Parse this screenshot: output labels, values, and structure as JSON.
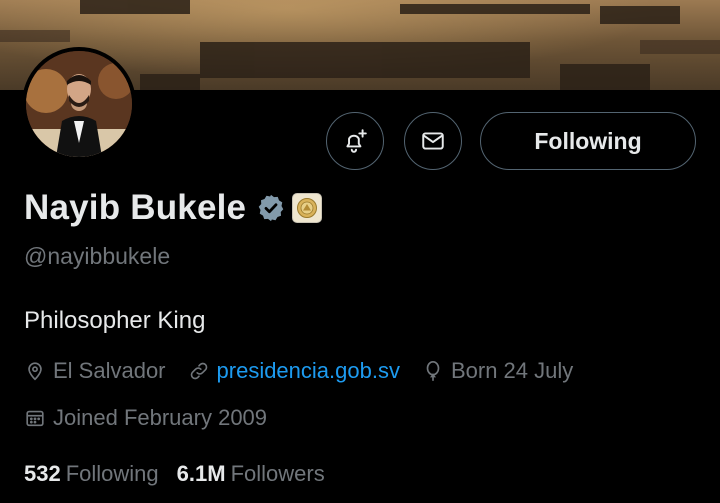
{
  "profile": {
    "name": "Nayib Bukele",
    "handle": "@nayibbukele",
    "bio": "Philosopher King",
    "location": "El Salvador",
    "website": "presidencia.gob.sv",
    "birthday": "Born 24 July",
    "joined": "Joined February 2009"
  },
  "stats": {
    "following_count": "532",
    "following_label": "Following",
    "followers_count": "6.1M",
    "followers_label": "Followers"
  },
  "buttons": {
    "follow_state": "Following"
  },
  "icons": {
    "notify": "bell-plus-icon",
    "message": "envelope-icon",
    "verified": "verified-badge-icon",
    "affiliation": "government-seal-icon",
    "location": "location-pin-icon",
    "website": "link-icon",
    "birthday": "balloon-icon",
    "joined": "calendar-icon"
  },
  "colors": {
    "background": "#000000",
    "text": "#e7e9ea",
    "secondary_text": "#71767b",
    "link": "#1d9bf0",
    "verified_badge": "#829aab",
    "button_border": "#536471"
  }
}
